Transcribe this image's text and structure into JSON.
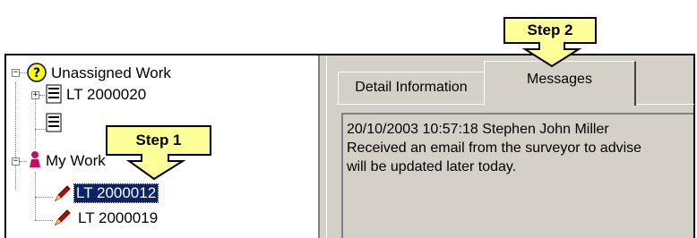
{
  "tree": {
    "unassigned": {
      "label": "Unassigned Work",
      "expander": "−"
    },
    "lt2000020": {
      "label": "LT 2000020",
      "expander": "+"
    },
    "my_work": {
      "label": "My Work",
      "expander": "−"
    },
    "lt2000012": {
      "label": "LT 2000012"
    },
    "lt2000019": {
      "label": "LT 2000019"
    }
  },
  "tabs": [
    {
      "label": "Detail Information",
      "active": false
    },
    {
      "label": "Messages",
      "active": true
    }
  ],
  "message": {
    "line1": "20/10/2003 10:57:18 Stephen John Miller",
    "line2": "Received an email from the surveyor to advise",
    "line3": "will be updated later today."
  },
  "callouts": {
    "step1": "Step 1",
    "step2": "Step 2"
  },
  "colors": {
    "selection": "#0a246a",
    "callout": "#ffff99",
    "window": "#d4d0c8"
  },
  "icons": [
    "help-question-icon",
    "document-icon",
    "user-icon",
    "pencil-icon"
  ]
}
